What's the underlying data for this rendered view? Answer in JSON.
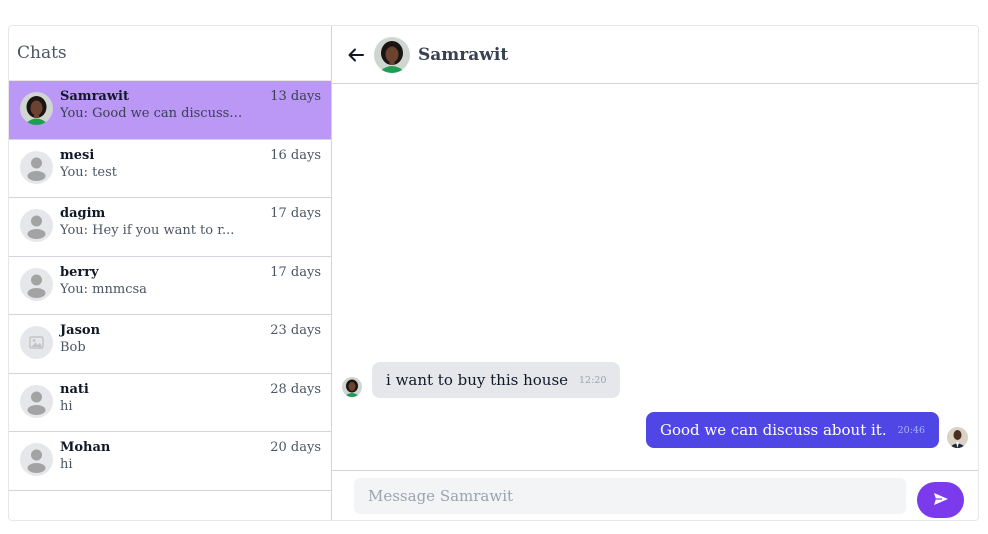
{
  "sidebar": {
    "title": "Chats",
    "chats": [
      {
        "name": "Samrawit",
        "time": "13 days",
        "preview": "You: Good we can discuss ...",
        "avatar": "photo-woman",
        "active": true
      },
      {
        "name": "mesi",
        "time": "16 days",
        "preview": "You: test",
        "avatar": "default-user-icon"
      },
      {
        "name": "dagim",
        "time": "17 days",
        "preview": "You: Hey if you want to r...",
        "avatar": "default-user-icon"
      },
      {
        "name": "berry",
        "time": "17 days",
        "preview": "You: mnmcsa",
        "avatar": "default-user-icon"
      },
      {
        "name": "Jason",
        "time": "23 days",
        "preview": "Bob",
        "avatar": "image-placeholder-icon"
      },
      {
        "name": "nati",
        "time": "28 days",
        "preview": "hi",
        "avatar": "default-user-icon"
      },
      {
        "name": "Mohan",
        "time": "20 days",
        "preview": "hi",
        "avatar": "default-user-icon"
      }
    ]
  },
  "header": {
    "contact_name": "Samrawit",
    "back_icon": "arrow-left-icon"
  },
  "messages": [
    {
      "direction": "incoming",
      "text": "i want to buy this house",
      "time": "12:20"
    },
    {
      "direction": "outgoing",
      "text": "Good we can discuss about it.",
      "time": "20:46"
    }
  ],
  "composer": {
    "placeholder": "Message Samrawit",
    "value": "",
    "send_icon": "paper-plane-icon"
  },
  "colors": {
    "active_chat": "#bb97f6",
    "outgoing_bubble": "#4f46e5",
    "incoming_bubble": "#e5e7eb",
    "send_button": "#7c3aed"
  }
}
